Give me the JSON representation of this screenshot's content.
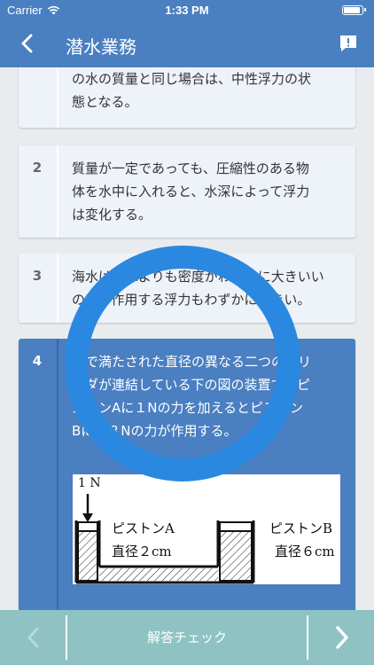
{
  "status": {
    "carrier": "Carrier",
    "time": "1:33 PM"
  },
  "nav": {
    "title": "潜水業務"
  },
  "options": [
    {
      "number": "",
      "lines": [
        "の水の質量と同じ場合は、中性浮力の状",
        "態となる。"
      ]
    },
    {
      "number": "2",
      "lines": [
        "質量が一定であっても、圧縮性のある物",
        "体を水中に入れると、水深によって浮力",
        "は変化する。"
      ]
    },
    {
      "number": "3",
      "lines": [
        "海水は淡水よりも密度がわずかに大きいい",
        "ので、作用する浮力もわずかに大きい。"
      ]
    },
    {
      "number": "4",
      "lines": [
        "水で満たされた直径の異なる二つのシリ",
        "ンダが連結している下の図の装置で、ピ",
        "ストンAに１Nの力を加えるとピストン",
        "Bには３Nの力が作用する。"
      ]
    }
  ],
  "figure": {
    "force": "1 N",
    "piston_a": "ピストンA",
    "diameter_a": "直径２cm",
    "piston_b": "ピストンB",
    "diameter_b": "直径６cm"
  },
  "footer": {
    "check_label": "解答チェック"
  },
  "colors": {
    "header": "#4a7fc1",
    "selected": "#4a7fc1",
    "ring": "#2b88e0",
    "footer": "#8fc3c3"
  }
}
